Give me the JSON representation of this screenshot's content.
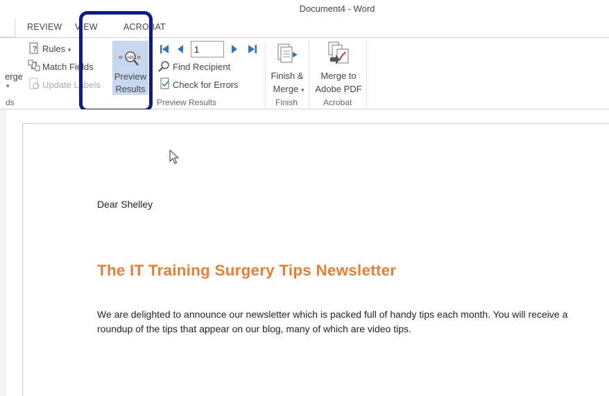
{
  "window": {
    "title": "Document4 - Word"
  },
  "tabs": [
    "REVIEW",
    "VIEW",
    "ACROBAT"
  ],
  "ribbon": {
    "merge_partial": "erge",
    "fields_group_partial": "ds",
    "rules_label": "Rules",
    "match_fields_label": "Match Fields",
    "update_labels_label": "Update Labels",
    "preview_results_line1": "Preview",
    "preview_results_line2": "Results",
    "record_number": "1",
    "find_recipient_label": "Find Recipient",
    "check_errors_label": "Check for Errors",
    "preview_group_label": "Preview Results",
    "finish_merge_line1": "Finish &",
    "finish_merge_line2": "Merge",
    "finish_group_label": "Finish",
    "merge_pdf_line1": "Merge to",
    "merge_pdf_line2": "Adobe PDF",
    "acrobat_group_label": "Acrobat"
  },
  "document": {
    "salutation": "Dear Shelley",
    "heading": "The IT Training Surgery Tips Newsletter",
    "paragraph": "We are delighted to announce our newsletter which is packed full of handy tips each month. You will receive a roundup of the tips that appear on our blog, many of which are video tips."
  },
  "colors": {
    "heading": "#ed7d31",
    "highlight_outline": "#0f1a8c",
    "active_button": "#c5d8ee",
    "nav_arrow": "#2e75b6"
  },
  "icons": [
    "rules-icon",
    "match-fields-icon",
    "update-labels-icon",
    "preview-results-icon",
    "first-record-icon",
    "previous-record-icon",
    "next-record-icon",
    "last-record-icon",
    "find-recipient-icon",
    "check-errors-icon",
    "finish-merge-icon",
    "merge-pdf-icon",
    "mouse-cursor-icon"
  ]
}
